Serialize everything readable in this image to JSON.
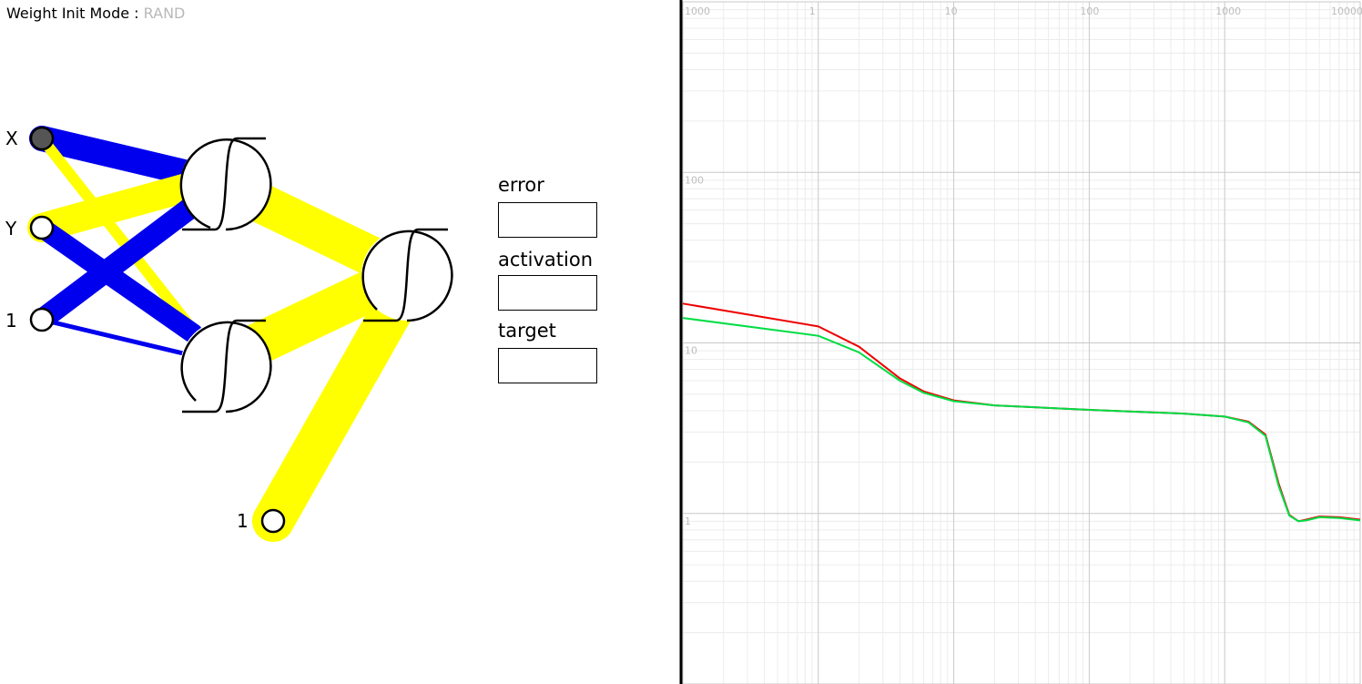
{
  "init_mode": {
    "label": "Weight Init Mode :",
    "value": "RAND"
  },
  "nodes": {
    "input_x": "X",
    "input_y": "Y",
    "input_bias": "1",
    "hidden_bias": "1"
  },
  "fields": {
    "error": {
      "label": "error",
      "value": ""
    },
    "activation": {
      "label": "activation",
      "value": ""
    },
    "target": {
      "label": "target",
      "value": ""
    }
  },
  "colors": {
    "positive_weight": "#ffff00",
    "negative_weight": "#0000ee",
    "active_input": "#555555",
    "error_series": "#ee0000",
    "training_series": "#00dd44",
    "grid_major": "#c8c8c8",
    "grid_minor": "#ececec"
  },
  "chart_data": {
    "type": "line",
    "x_scale": "log",
    "y_scale": "log",
    "x_tick_labels": [
      "1000",
      "1",
      "10",
      "100",
      "1000",
      "10000"
    ],
    "y_tick_labels": [
      "1000",
      "100",
      "10",
      "1"
    ],
    "xlim": [
      0.1,
      10000
    ],
    "ylim": [
      0.1,
      1000
    ],
    "grid": true,
    "series": [
      {
        "color": "#ee0000",
        "x": [
          0.1,
          1,
          2,
          4,
          6,
          10,
          20,
          100,
          500,
          1000,
          1500,
          2000,
          2500,
          3000,
          3500,
          4000,
          5000,
          7000,
          10000
        ],
        "y": [
          17,
          12.5,
          9.5,
          6.2,
          5.2,
          4.6,
          4.3,
          4.05,
          3.85,
          3.7,
          3.45,
          2.9,
          1.5,
          0.98,
          0.9,
          0.92,
          0.96,
          0.95,
          0.92
        ]
      },
      {
        "color": "#00dd44",
        "x": [
          0.1,
          1,
          2,
          4,
          6,
          10,
          20,
          100,
          500,
          1000,
          1500,
          2000,
          2500,
          3000,
          3500,
          4000,
          5000,
          7000,
          10000
        ],
        "y": [
          14,
          11,
          8.8,
          6.0,
          5.1,
          4.55,
          4.3,
          4.05,
          3.85,
          3.7,
          3.42,
          2.85,
          1.45,
          0.97,
          0.9,
          0.91,
          0.95,
          0.94,
          0.91
        ]
      }
    ]
  }
}
